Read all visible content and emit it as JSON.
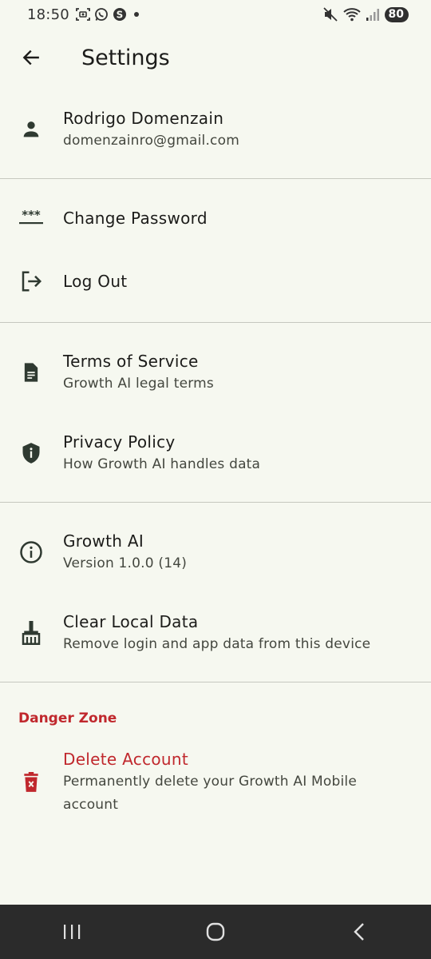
{
  "status_bar": {
    "time": "18:50",
    "battery": "80",
    "left_icons": [
      "screenshot-icon",
      "whatsapp-icon",
      "skype-icon",
      "dot-icon"
    ],
    "right_icons": [
      "mute-icon",
      "wifi-icon",
      "signal-icon"
    ]
  },
  "app_bar": {
    "title": "Settings",
    "back_icon": "arrow-left-icon"
  },
  "account": {
    "name": "Rodrigo Domenzain",
    "email": "domenzainro@gmail.com",
    "icon": "person-icon"
  },
  "account_actions": {
    "change_password": {
      "title": "Change Password",
      "icon": "password-icon"
    },
    "log_out": {
      "title": "Log Out",
      "icon": "logout-icon"
    }
  },
  "legal": {
    "terms": {
      "title": "Terms of Service",
      "subtitle": "Growth AI legal terms",
      "icon": "document-icon"
    },
    "privacy": {
      "title": "Privacy Policy",
      "subtitle": "How Growth AI handles data",
      "icon": "shield-icon"
    }
  },
  "app_info": {
    "about": {
      "title": "Growth AI",
      "subtitle": "Version 1.0.0 (14)",
      "icon": "info-icon"
    },
    "clear_data": {
      "title": "Clear Local Data",
      "subtitle": "Remove login and app data from this device",
      "icon": "broom-icon"
    }
  },
  "danger_zone": {
    "header": "Danger Zone",
    "delete_account": {
      "title": "Delete Account",
      "subtitle": "Permanently delete your Growth AI Mobile account",
      "icon": "delete-icon"
    }
  },
  "nav_bar": {
    "recents_icon": "recents-icon",
    "home_icon": "home-icon",
    "back_icon": "back-nav-icon"
  },
  "colors": {
    "background": "#f6f8f0",
    "danger": "#c0282d",
    "icon": "#2f3a31",
    "divider": "#c6c8bf",
    "nav_bar": "#2b2b2b"
  }
}
